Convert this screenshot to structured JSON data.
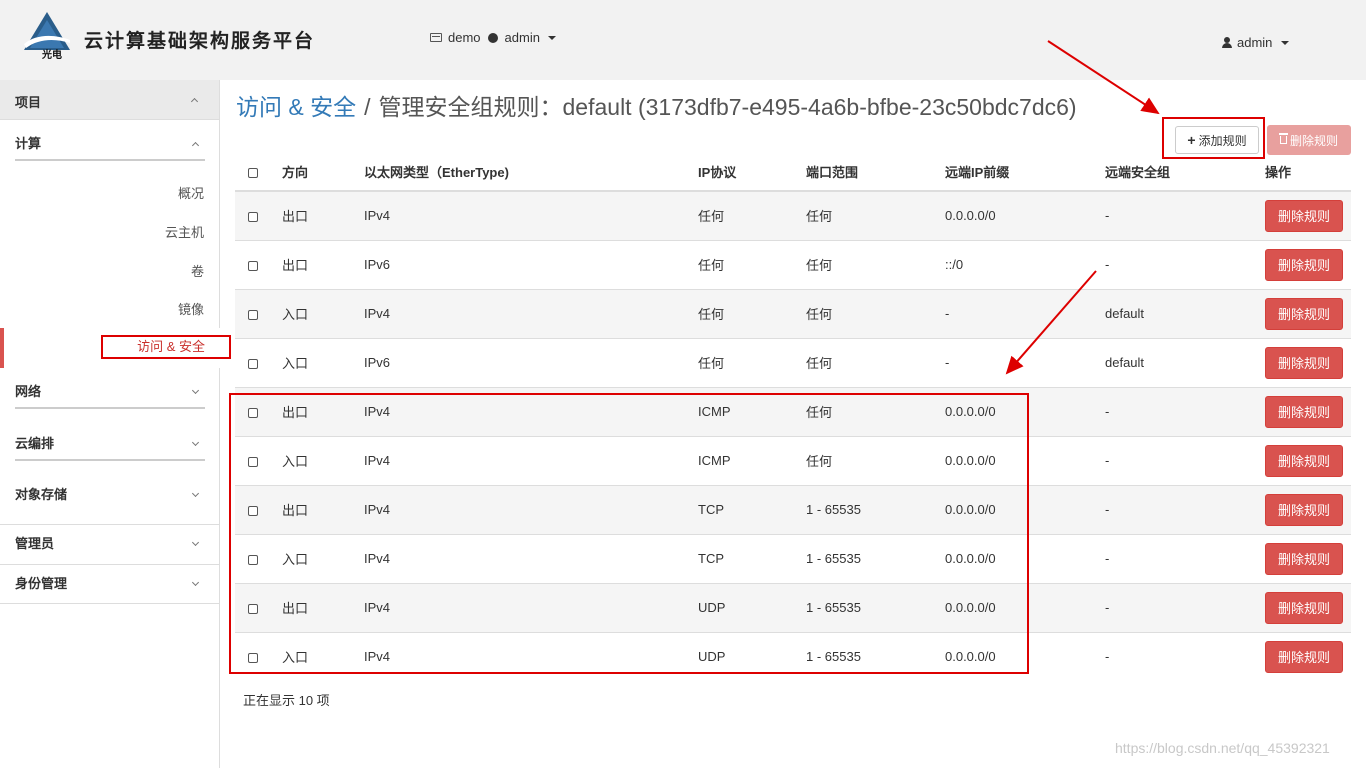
{
  "header": {
    "brand": "云计算基础架构服务平台",
    "logo_text": "光电",
    "project": "demo",
    "project_user": "admin",
    "user": "admin"
  },
  "sidebar": {
    "project_label": "项目",
    "compute_label": "计算",
    "compute_items": [
      "概况",
      "云主机",
      "卷",
      "镜像"
    ],
    "active_item": "访问 & 安全",
    "sections": [
      "网络",
      "云编排",
      "对象存储"
    ],
    "admin_label": "管理员",
    "identity_label": "身份管理"
  },
  "page": {
    "crumb": "访问 & 安全",
    "separator": "/",
    "title": "管理安全组规则：default (3173dfb7-e495-4a6b-bfbe-23c50bdc7dc6)"
  },
  "actions": {
    "add_rule": "添加规则",
    "delete_rules": "删除规则"
  },
  "table": {
    "headers": [
      "方向",
      "以太网类型（EtherType)",
      "IP协议",
      "端口范围",
      "远端IP前缀",
      "远端安全组",
      "操作"
    ],
    "row_action": "删除规则",
    "rows": [
      {
        "direction": "出口",
        "ethertype": "IPv4",
        "protocol": "任何",
        "ports": "任何",
        "ip_prefix": "0.0.0.0/0",
        "sec_group": "-"
      },
      {
        "direction": "出口",
        "ethertype": "IPv6",
        "protocol": "任何",
        "ports": "任何",
        "ip_prefix": "::/0",
        "sec_group": "-"
      },
      {
        "direction": "入口",
        "ethertype": "IPv4",
        "protocol": "任何",
        "ports": "任何",
        "ip_prefix": "-",
        "sec_group": "default"
      },
      {
        "direction": "入口",
        "ethertype": "IPv6",
        "protocol": "任何",
        "ports": "任何",
        "ip_prefix": "-",
        "sec_group": "default"
      },
      {
        "direction": "出口",
        "ethertype": "IPv4",
        "protocol": "ICMP",
        "ports": "任何",
        "ip_prefix": "0.0.0.0/0",
        "sec_group": "-"
      },
      {
        "direction": "入口",
        "ethertype": "IPv4",
        "protocol": "ICMP",
        "ports": "任何",
        "ip_prefix": "0.0.0.0/0",
        "sec_group": "-"
      },
      {
        "direction": "出口",
        "ethertype": "IPv4",
        "protocol": "TCP",
        "ports": "1 - 65535",
        "ip_prefix": "0.0.0.0/0",
        "sec_group": "-"
      },
      {
        "direction": "入口",
        "ethertype": "IPv4",
        "protocol": "TCP",
        "ports": "1 - 65535",
        "ip_prefix": "0.0.0.0/0",
        "sec_group": "-"
      },
      {
        "direction": "出口",
        "ethertype": "IPv4",
        "protocol": "UDP",
        "ports": "1 - 65535",
        "ip_prefix": "0.0.0.0/0",
        "sec_group": "-"
      },
      {
        "direction": "入口",
        "ethertype": "IPv4",
        "protocol": "UDP",
        "ports": "1 - 65535",
        "ip_prefix": "0.0.0.0/0",
        "sec_group": "-"
      }
    ]
  },
  "footer": {
    "count_text": "正在显示 10 项"
  },
  "watermark": "https://blog.csdn.net/qq_45392321",
  "colors": {
    "danger": "#d9534f",
    "danger_disabled": "#e8a09e",
    "link": "#337ab7",
    "annotation": "#dd0000"
  }
}
